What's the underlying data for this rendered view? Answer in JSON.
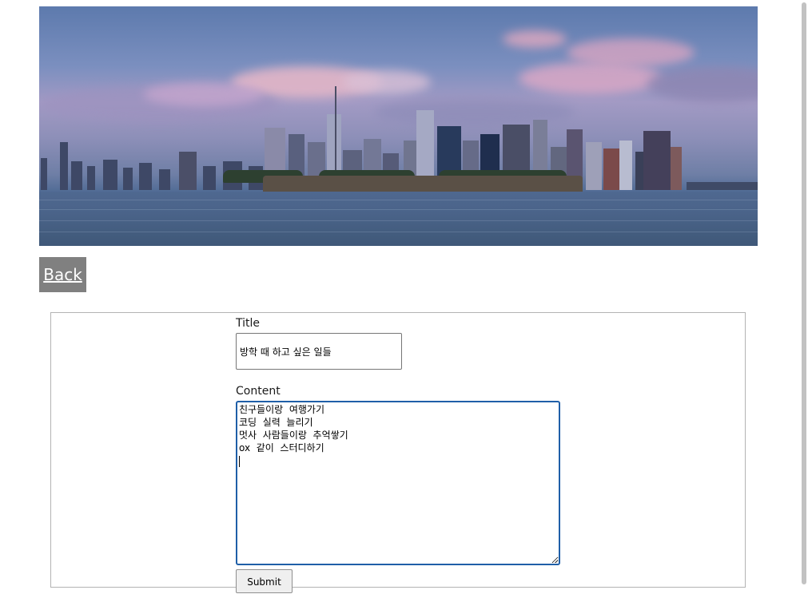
{
  "banner": {
    "image_name": "city-skyline-image"
  },
  "nav": {
    "back_label": "Back"
  },
  "form": {
    "title_label": "Title",
    "title_value": "방학 때 하고 싶은 일들",
    "content_label": "Content",
    "content_lines": [
      "친구들이랑  여행가기",
      "코딩  실력  늘리기",
      "멋사  사람들이랑  추억쌓기",
      "ox  같이  스터디하기"
    ],
    "submit_label": "Submit"
  },
  "colors": {
    "back_button_bg": "#808080",
    "focus_border": "#1f5fa8"
  }
}
